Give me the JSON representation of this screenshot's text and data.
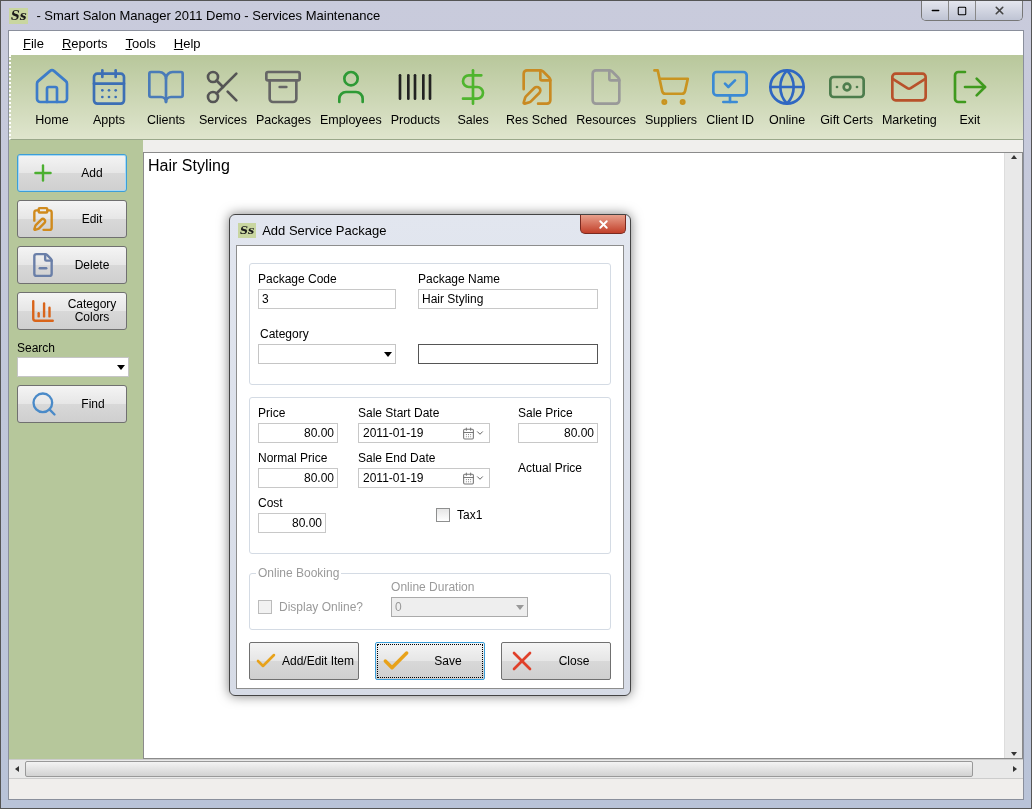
{
  "window": {
    "title": "- Smart Salon Manager 2011 Demo - Services Maintenance",
    "logo": "Ss"
  },
  "menu": [
    "File",
    "Reports",
    "Tools",
    "Help"
  ],
  "toolbar": [
    "Home",
    "Appts",
    "Clients",
    "Services",
    "Packages",
    "Employees",
    "Products",
    "Sales",
    "Res Sched",
    "Resources",
    "Suppliers",
    "Client ID",
    "Online",
    "Gift Certs",
    "Marketing",
    "Exit"
  ],
  "sidebar": {
    "buttons": [
      {
        "label": "Add",
        "focused": true
      },
      {
        "label": "Edit",
        "focused": false
      },
      {
        "label": "Delete",
        "focused": false
      },
      {
        "label": "Category Colors",
        "focused": false
      }
    ],
    "search": {
      "label": "Search"
    },
    "find": {
      "label": "Find"
    }
  },
  "content": {
    "heading": "Hair Styling"
  },
  "dialog": {
    "title": "Add Service Package",
    "logo": "Ss",
    "package_code": {
      "label": "Package Code",
      "value": "3"
    },
    "package_name": {
      "label": "Package Name",
      "value": "Hair Styling"
    },
    "category": {
      "label": "Category"
    },
    "price": {
      "label": "Price",
      "value": "80.00"
    },
    "sale_start": {
      "label": "Sale Start Date",
      "value": "2011-01-19"
    },
    "sale_price": {
      "label": "Sale Price",
      "value": "80.00"
    },
    "normal_price": {
      "label": "Normal Price",
      "value": "80.00"
    },
    "sale_end": {
      "label": "Sale End Date",
      "value": "2011-01-19"
    },
    "actual_price": {
      "label": "Actual Price"
    },
    "cost": {
      "label": "Cost",
      "value": "80.00"
    },
    "tax1": {
      "label": "Tax1",
      "checked": false
    },
    "online_booking": {
      "legend": "Online Booking",
      "disabled": true,
      "display_online": {
        "label": "Display Online?",
        "checked": false
      },
      "duration": {
        "label": "Online Duration",
        "value": "0"
      }
    },
    "buttons": [
      {
        "label": "Add/Edit Item",
        "kind": "check",
        "focused": false
      },
      {
        "label": "Save",
        "kind": "check",
        "focused": true
      },
      {
        "label": "Close",
        "kind": "cross",
        "focused": false
      }
    ]
  }
}
